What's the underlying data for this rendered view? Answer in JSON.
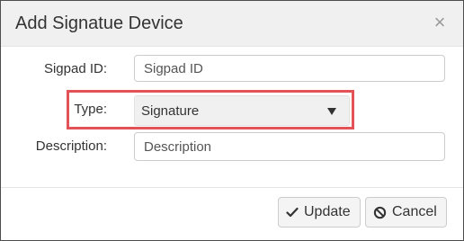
{
  "dialog": {
    "title": "Add Signatue Device",
    "close_glyph": "×"
  },
  "form": {
    "sigpad_id": {
      "label": "Sigpad ID:",
      "placeholder": "Sigpad ID",
      "value": ""
    },
    "type": {
      "label": "Type:",
      "value": "Signature"
    },
    "description": {
      "label": "Description:",
      "placeholder": "Description",
      "value": ""
    }
  },
  "buttons": {
    "update_label": "Update",
    "cancel_label": "Cancel"
  },
  "icons": {
    "close": "close-icon",
    "update": "check-icon",
    "cancel": "ban-icon",
    "dropdown": "caret-down-icon"
  },
  "colors": {
    "highlight": "#e35256",
    "header_bg": "#f0f0f0",
    "button_bg": "#f4f4f4"
  }
}
